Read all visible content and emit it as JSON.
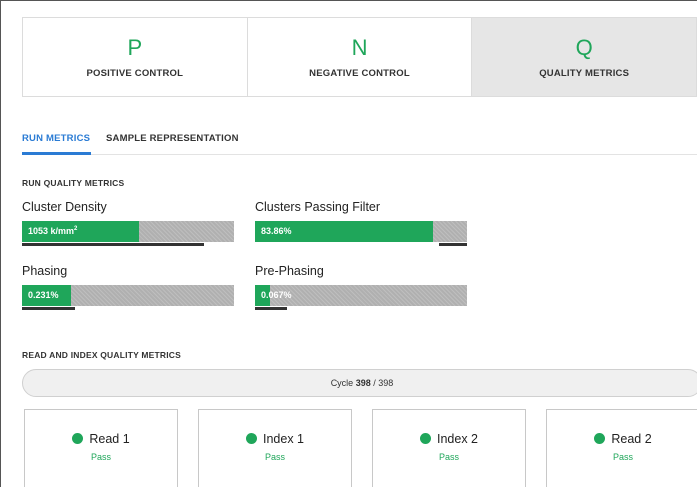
{
  "controls": [
    {
      "letter": "P",
      "label": "POSITIVE CONTROL",
      "active": false
    },
    {
      "letter": "N",
      "label": "NEGATIVE CONTROL",
      "active": false
    },
    {
      "letter": "Q",
      "label": "QUALITY METRICS",
      "active": true
    }
  ],
  "tabs": [
    {
      "label": "RUN METRICS",
      "active": true
    },
    {
      "label": "SAMPLE REPRESENTATION",
      "active": false
    }
  ],
  "run_quality": {
    "title": "RUN QUALITY METRICS",
    "metrics": [
      {
        "label": "Cluster Density",
        "value": "1053 k/mm",
        "superscript": "2",
        "fill_fraction": 0.55,
        "marker_fraction": 0.86
      },
      {
        "label": "Clusters Passing Filter",
        "value": "83.86%",
        "fill_fraction": 0.84,
        "marker_fraction": 0.13
      },
      {
        "label": "Phasing",
        "value": "0.231%",
        "fill_fraction": 0.23,
        "marker_fraction": 0.25
      },
      {
        "label": "Pre-Phasing",
        "value": "0.067%",
        "fill_fraction": 0.07,
        "marker_fraction": 0.15
      }
    ]
  },
  "read_index": {
    "title": "READ AND INDEX QUALITY METRICS",
    "cycle_prefix": "Cycle",
    "cycle_current": "398",
    "cycle_total": "/ 398",
    "reads": [
      {
        "label": "Read 1",
        "status": "Pass"
      },
      {
        "label": "Index 1",
        "status": "Pass"
      },
      {
        "label": "Index 2",
        "status": "Pass"
      },
      {
        "label": "Read 2",
        "status": "Pass"
      }
    ]
  },
  "colors": {
    "accent_green": "#1fa65a",
    "tab_blue": "#2a7bd4",
    "bar_gray": "#b0b0b0"
  }
}
